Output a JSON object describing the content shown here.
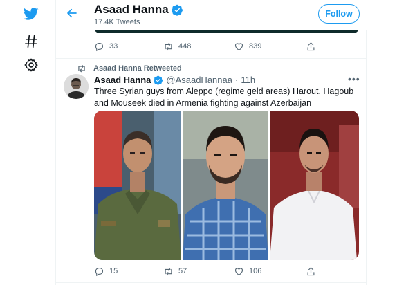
{
  "profile": {
    "name": "Asaad Hanna",
    "tweet_count": "17.4K Tweets",
    "follow_label": "Follow"
  },
  "nav": {
    "icons": [
      "twitter-logo-icon",
      "hashtag-icon",
      "settings-icon"
    ]
  },
  "prev_tweet": {
    "replies": "33",
    "retweets": "448",
    "likes": "839"
  },
  "tweet": {
    "retweet_label": "Asaad Hanna Retweeted",
    "name": "Asaad Hanna",
    "handle": "@AsaadHannaa",
    "separator": "·",
    "time": "11h",
    "text": "Three Syrian guys from Aleppo (regime geld areas) Harout, Hagoub and Mouseek died in Armenia fighting against Azerbaijan",
    "replies": "15",
    "retweets": "57",
    "likes": "106"
  },
  "colors": {
    "accent": "#1d9bf0",
    "verified": "#1d9bf0",
    "muted": "#536471"
  }
}
